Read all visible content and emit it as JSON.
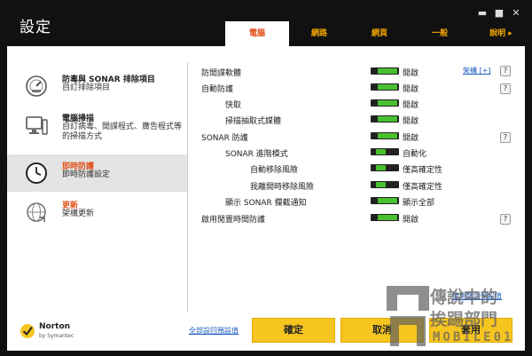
{
  "window": {
    "title": "設定",
    "minimize": "▬",
    "maximize": "■",
    "close": "✕"
  },
  "tabs": [
    {
      "label": "電腦",
      "active": true
    },
    {
      "label": "網路"
    },
    {
      "label": "網頁"
    },
    {
      "label": "一般"
    },
    {
      "label": "說明 ▸"
    }
  ],
  "nav": [
    {
      "title": "防毒與 SONAR 排除項目",
      "desc": "自訂排除項目",
      "icon": "gauge-icon"
    },
    {
      "title": "電腦掃描",
      "desc": "自訂病毒、間諜程式、廣告程式等的掃描方式",
      "icon": "computer-scan-icon"
    },
    {
      "title": "即時防護",
      "desc": "即時防護設定",
      "icon": "clock-icon",
      "active": true
    },
    {
      "title": "更新",
      "desc": "架構更新",
      "icon": "globe-update-icon"
    }
  ],
  "settings": [
    {
      "label": "防間諜軟體",
      "state": "開啟",
      "level": 1.0,
      "config": "架構 [+]",
      "help": "?"
    },
    {
      "label": "自動防護",
      "state": "開啟",
      "level": 1.0,
      "help": "?"
    },
    {
      "label": "快取",
      "state": "開啟",
      "level": 1.0
    },
    {
      "label": "掃描抽取式媒體",
      "state": "開啟",
      "level": 1.0
    },
    {
      "label": "SONAR 防護",
      "state": "開啟",
      "level": 1.0,
      "help": "?"
    },
    {
      "label": "SONAR 進階模式",
      "state": "自動化",
      "level": 0.5
    },
    {
      "label": "自動移除風險",
      "state": "僅高確定性",
      "level": 0.5
    },
    {
      "label": "我離開時移除風險",
      "state": "僅高確定性",
      "level": 0.5
    },
    {
      "label": "顯示 SONAR 攔截通知",
      "state": "顯示全部",
      "level": 1.0
    },
    {
      "label": "啟用閒置時間防護",
      "state": "開啟",
      "level": 1.0,
      "help": "?"
    }
  ],
  "footer": {
    "use_category_defaults": "使用類別預設值",
    "reset_all_defaults": "全部設回預設值",
    "ok": "確定",
    "cancel": "取消",
    "apply": "套用",
    "brand": "Norton",
    "brand_sub": "by Symantec"
  },
  "watermark": {
    "line1": "傳說中的",
    "line2": "挨踢部門",
    "line3": "MOBILE01"
  },
  "colors": {
    "accent_orange": "#e0501a",
    "tab_yellow": "#f5a800",
    "toggle_green": "#49c02e",
    "button_yellow": "#f7c520",
    "link_blue": "#1f5fbf"
  }
}
